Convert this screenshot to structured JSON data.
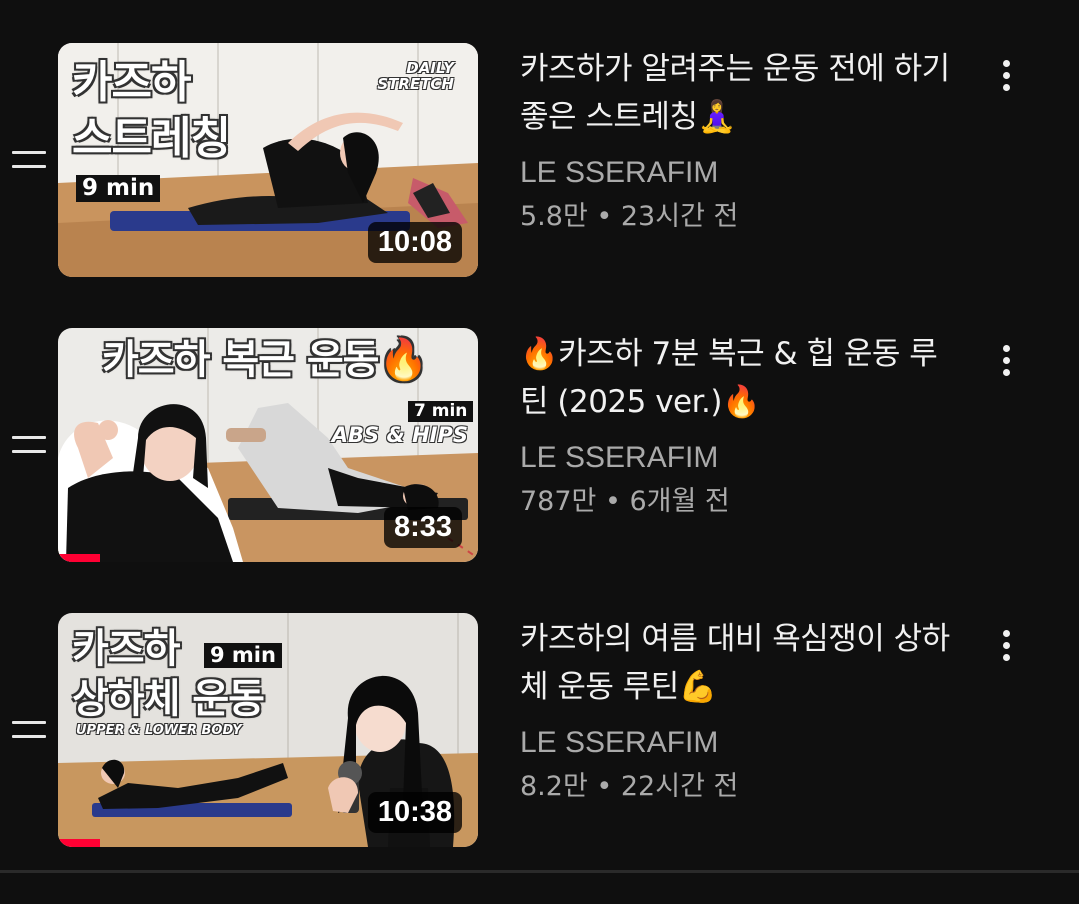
{
  "playlist": {
    "items": [
      {
        "title": "카즈하가 알려주는 운동 전에 하기 좋은 스트레칭🧘‍♀️",
        "channel": "LE SSERAFIM",
        "views": "5.8만",
        "separator": " • ",
        "age": "23시간 전",
        "duration": "10:08",
        "watched_fraction": 0,
        "thumbnail": {
          "title_line1": "카즈하",
          "title_line2": "스트레칭",
          "tag": "9 min",
          "corner_label_line1": "DAILY",
          "corner_label_line2": "STRETCH"
        }
      },
      {
        "title": "🔥카즈하 7분 복근 & 힙 운동 루틴 (2025 ver.)🔥",
        "channel": "LE SSERAFIM",
        "views": "787만",
        "separator": " • ",
        "age": "6개월 전",
        "duration": "8:33",
        "watched_fraction": 0.1,
        "thumbnail": {
          "title_line1": "카즈하 복근 운동🔥",
          "tag": "7 min",
          "corner_label_line1": "ABS & HIPS"
        }
      },
      {
        "title": "카즈하의 여름 대비 욕심쟁이 상하체 운동 루틴💪",
        "channel": "LE SSERAFIM",
        "views": "8.2만",
        "separator": " • ",
        "age": "22시간 전",
        "duration": "10:38",
        "watched_fraction": 0.1,
        "thumbnail": {
          "title_line1": "카즈하",
          "title_line2": "상하체 운동",
          "tag": "9 min",
          "corner_label_line1": "UPPER & LOWER BODY"
        }
      }
    ]
  },
  "icons": {
    "drag": "drag-handle-icon",
    "more": "more-vertical-icon"
  },
  "colors": {
    "background": "#0f0f0f",
    "title_text": "#f1f1f1",
    "secondary_text": "#aaaaaa",
    "progress_red": "#ff0033"
  }
}
